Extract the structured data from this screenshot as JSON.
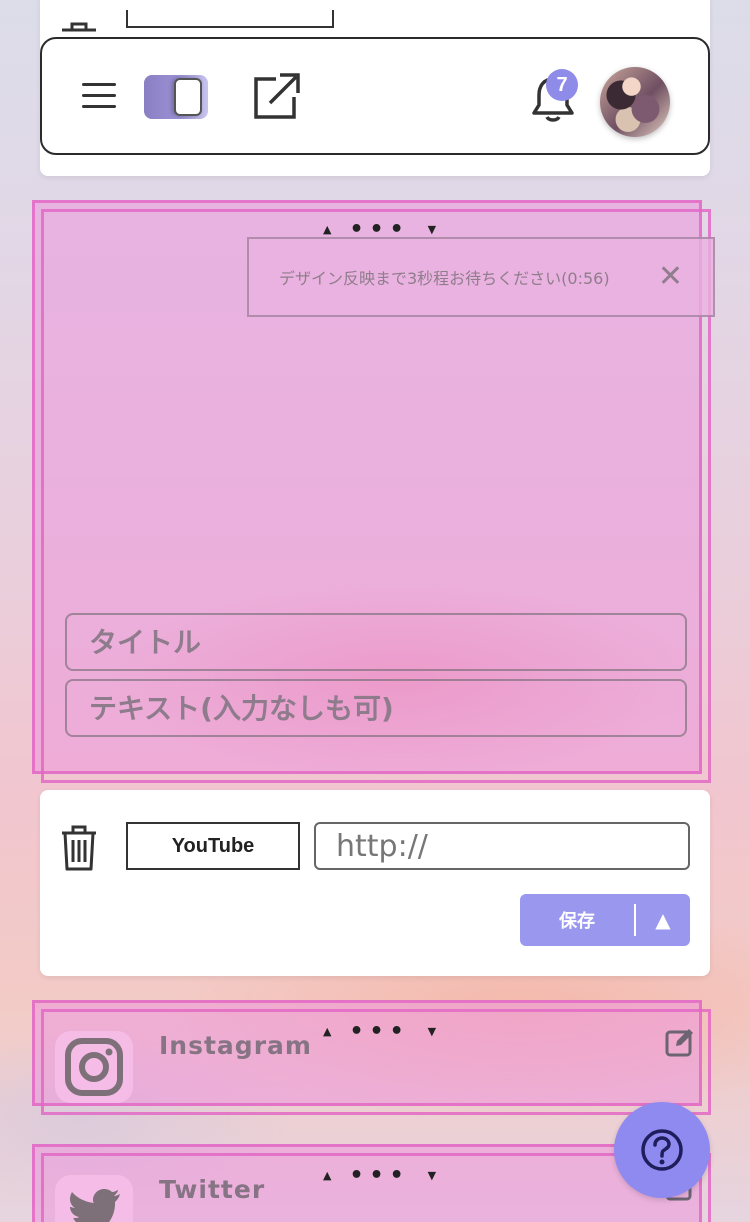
{
  "toolbar": {
    "notification_count": "7"
  },
  "image_block": {
    "toast_text": "デザイン反映まで3秒程お待ちください(0:56)",
    "toast_close": "✕",
    "title_placeholder": "タイトル",
    "text_placeholder": "テキスト(入力なしも可)"
  },
  "youtube_card": {
    "service_label": "YouTube",
    "url_placeholder": "http://",
    "save_label": "保存",
    "save_caret": "▲"
  },
  "links": [
    {
      "name": "Instagram",
      "icon": "instagram-icon"
    },
    {
      "name": "Twitter",
      "icon": "twitter-icon"
    }
  ],
  "drag_handle": {
    "up": "▲",
    "dots": "•••",
    "down": "▼"
  },
  "colors": {
    "accent": "#9a97ef",
    "badge": "#8f8be8",
    "pink_block": "#ec96dc",
    "pink_border": "#e268c4"
  }
}
